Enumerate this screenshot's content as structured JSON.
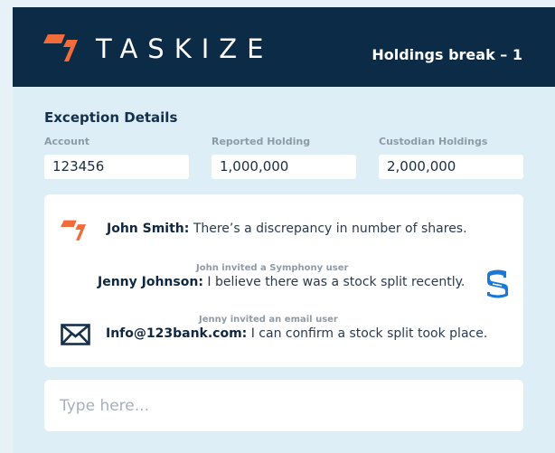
{
  "header": {
    "brand": "TASKIZE",
    "title": "Holdings break – 1",
    "brand_color": "#f26b3a",
    "background": "#0c2b47"
  },
  "exception": {
    "title": "Exception Details",
    "fields": [
      {
        "label": "Account",
        "value": "123456"
      },
      {
        "label": "Reported Holding",
        "value": "1,000,000"
      },
      {
        "label": "Custodian Holdings",
        "value": "2,000,000"
      }
    ]
  },
  "chat": {
    "messages": [
      {
        "sender": "John Smith:",
        "text": " There’s a discrepancy in number of shares.",
        "icon": "taskize-logo-icon"
      },
      {
        "note": "John invited a Symphony user",
        "sender": "Jenny Johnson:",
        "text": " I believe there was a stock split recently.",
        "icon": "symphony-icon"
      },
      {
        "note": "Jenny invited an email user",
        "sender": "Info@123bank.com:",
        "text": " I can confirm a stock split took place.",
        "icon": "envelope-icon"
      }
    ]
  },
  "composer": {
    "placeholder": "Type here..."
  }
}
